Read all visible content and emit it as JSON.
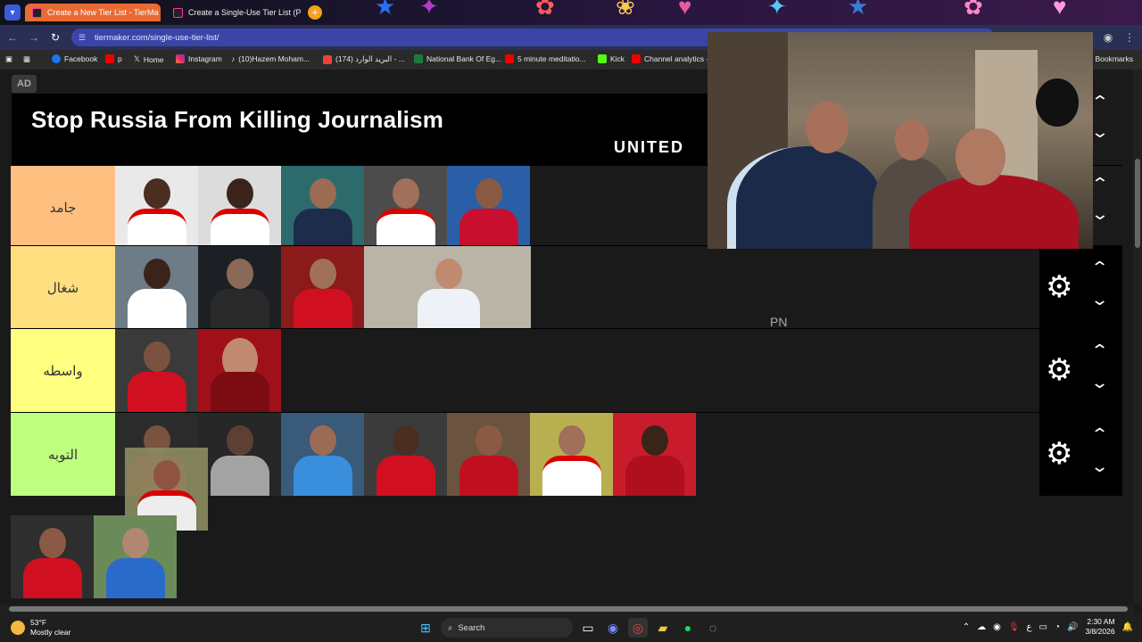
{
  "browser": {
    "tabs": [
      {
        "title": "Create a New Tier List - TierMa",
        "active": true
      },
      {
        "title": "Create a Single-Use Tier List (P",
        "active": false
      }
    ],
    "url": "tiermaker.com/single-use-tier-list/",
    "bookmarks": [
      "Facebook",
      "p",
      "Home",
      "Instagram",
      "(10)Hazem Moham...",
      "(174) البريد الوارد - ...",
      "National Bank Of Eg...",
      "5 minute meditatio...",
      "Kick",
      "Channel analytics -..."
    ],
    "all_bookmarks": "All Bookmarks"
  },
  "ad": {
    "badge": "AD",
    "headline": "Stop Russia From Killing Journalism",
    "brand": "UNITED"
  },
  "tiers": [
    {
      "label": "جامد",
      "color": "#ffbf7f",
      "count": 5
    },
    {
      "label": "شغال",
      "color": "#ffdf7f",
      "count": 4
    },
    {
      "label": "واسطه",
      "color": "#ffff7f",
      "count": 2
    },
    {
      "label": "التوبه",
      "color": "#bfff7f",
      "count": 7
    }
  ],
  "overlay_text": "PN",
  "taskbar": {
    "temperature": "53°F",
    "condition": "Mostly clear",
    "search_placeholder": "Search",
    "time": "2:30 AM",
    "date": "3/8/2026",
    "lang": "ع"
  },
  "colors": {
    "accent_tab": "#e96a33",
    "omnibox": "#3b45a8"
  }
}
